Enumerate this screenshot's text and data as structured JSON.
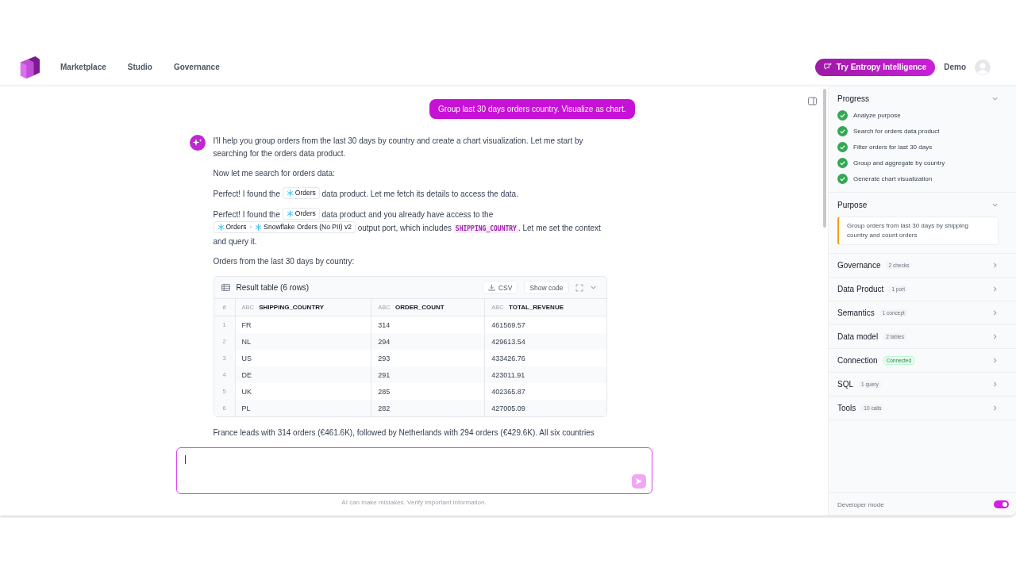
{
  "nav": {
    "items": [
      {
        "label": "Marketplace",
        "selected": false
      },
      {
        "label": "Studio",
        "selected": false
      },
      {
        "label": "Governance",
        "selected": false
      }
    ],
    "cta": "Try Entropy Intelligence",
    "user": "Demo"
  },
  "chat": {
    "user_message": "Group last 30 days orders country. Visualize as chart.",
    "assistant": [
      {
        "kind": "paragraph",
        "segments": [
          {
            "kind": "text",
            "text": "I'll help you group orders from the last 30 days by country and create a chart visualization. Let me start by searching for the orders data product."
          }
        ]
      },
      {
        "kind": "paragraph",
        "segments": [
          {
            "kind": "text",
            "text": "Now let me search for orders data:"
          }
        ]
      },
      {
        "kind": "paragraph",
        "segments": [
          {
            "kind": "text",
            "text": "Perfect! I found the "
          },
          {
            "kind": "chip",
            "parts": [
              "Orders"
            ]
          },
          {
            "kind": "text",
            "text": " data product. Let me fetch its details to access the data."
          }
        ]
      },
      {
        "kind": "paragraph",
        "segments": [
          {
            "kind": "text",
            "text": "Perfect! I found the "
          },
          {
            "kind": "chip",
            "parts": [
              "Orders"
            ]
          },
          {
            "kind": "text",
            "text": " data product and you already have access to the "
          },
          {
            "kind": "chip",
            "parts": [
              "Orders",
              "Snowflake Orders (No PII) v2"
            ],
            "separator": "›"
          },
          {
            "kind": "text",
            "text": " output port, which includes "
          },
          {
            "kind": "code",
            "text": "SHIPPING_COUNTRY"
          },
          {
            "kind": "text",
            "text": ". Let me set the context and query it."
          }
        ]
      },
      {
        "kind": "paragraph",
        "segments": [
          {
            "kind": "text",
            "text": "Orders from the last 30 days by country:"
          }
        ]
      },
      {
        "kind": "table",
        "title": "Result table (6 rows)",
        "actions": [
          "CSV",
          "Show code"
        ],
        "columns": [
          {
            "name": "#"
          },
          {
            "type": "ABC",
            "name": "SHIPPING_COUNTRY"
          },
          {
            "type": "ABC",
            "name": "ORDER_COUNT"
          },
          {
            "type": "ABC",
            "name": "TOTAL_REVENUE"
          }
        ],
        "rows": [
          [
            "1",
            "FR",
            "314",
            "461569.57"
          ],
          [
            "2",
            "NL",
            "294",
            "429613.54"
          ],
          [
            "3",
            "US",
            "293",
            "433426.76"
          ],
          [
            "4",
            "DE",
            "291",
            "423011.91"
          ],
          [
            "5",
            "UK",
            "285",
            "402365.87"
          ],
          [
            "6",
            "PL",
            "282",
            "427005.09"
          ]
        ]
      },
      {
        "kind": "paragraph",
        "segments": [
          {
            "kind": "text",
            "text": "France leads with 314 orders (€461.6K), followed by Netherlands with 294 orders (€429.6K). All six countries"
          }
        ]
      }
    ],
    "disclaimer": "AI can make mistakes. Verify important information."
  },
  "sidebar": {
    "progress": {
      "title": "Progress",
      "expanded": true,
      "steps": [
        {
          "label": "Analyze purpose",
          "done": true
        },
        {
          "label": "Search for orders data product",
          "done": true
        },
        {
          "label": "Filter orders for last 30 days",
          "done": true
        },
        {
          "label": "Group and aggregate by country",
          "done": true
        },
        {
          "label": "Generate chart visualization",
          "done": true
        }
      ]
    },
    "purpose": {
      "title": "Purpose",
      "expanded": true,
      "text": "Group orders from last 30 days by shipping country and count orders"
    },
    "sections": [
      {
        "title": "Governance",
        "badge": "2 checks",
        "kind": "count",
        "expanded": false
      },
      {
        "title": "Data Product",
        "badge": "1 port",
        "kind": "count",
        "expanded": false
      },
      {
        "title": "Semantics",
        "badge": "1 concept",
        "kind": "count",
        "expanded": false
      },
      {
        "title": "Data model",
        "badge": "2 tables",
        "kind": "count",
        "expanded": false
      },
      {
        "title": "Connection",
        "badge": "Connected",
        "kind": "status",
        "expanded": false
      },
      {
        "title": "SQL",
        "badge": "1 query",
        "kind": "count",
        "expanded": false
      },
      {
        "title": "Tools",
        "badge": "10 calls",
        "kind": "count",
        "expanded": false
      }
    ],
    "developer_mode": {
      "label": "Developer mode",
      "on": true
    }
  }
}
